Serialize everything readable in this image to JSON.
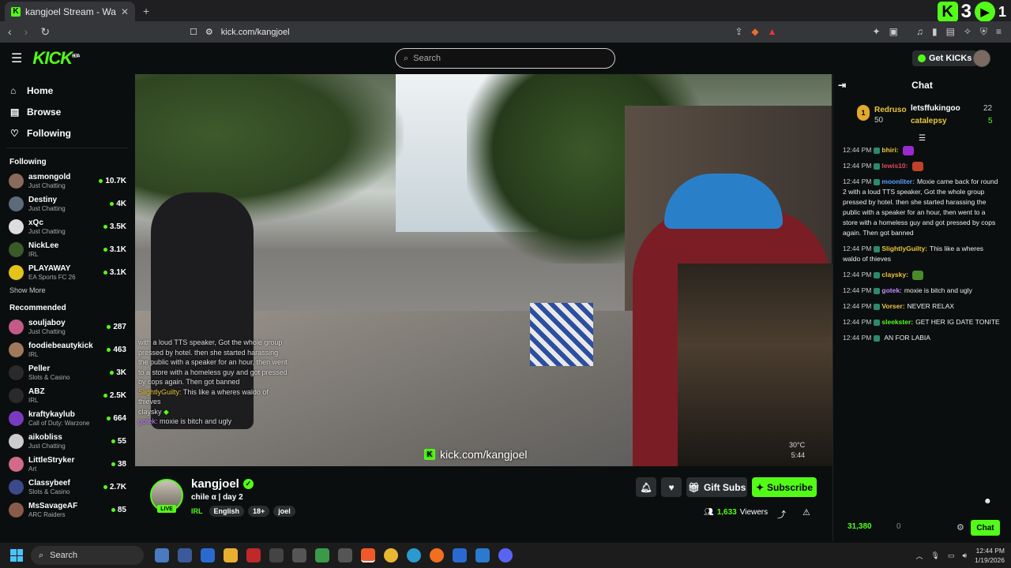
{
  "browser": {
    "tab_title": "kangjoel Stream - Watch Live",
    "url": "kick.com/kangjoel",
    "corner_count1": "3",
    "corner_count2": "1"
  },
  "header": {
    "logo": "KICK",
    "logo_beta": "BETA",
    "search_placeholder": "Search",
    "get_kicks": "Get KICKs"
  },
  "sidebar": {
    "nav": [
      {
        "label": "Home",
        "icon": "home-icon"
      },
      {
        "label": "Browse",
        "icon": "browse-icon"
      },
      {
        "label": "Following",
        "icon": "heart-icon"
      }
    ],
    "following_title": "Following",
    "following": [
      {
        "name": "asmongold",
        "category": "Just Chatting",
        "viewers": "10.7K",
        "color": "#8a6a5a"
      },
      {
        "name": "Destiny",
        "category": "Just Chatting",
        "viewers": "4K",
        "color": "#5c6b7a"
      },
      {
        "name": "xQc",
        "category": "Just Chatting",
        "viewers": "3.5K",
        "color": "#dddddd"
      },
      {
        "name": "NickLee",
        "category": "IRL",
        "viewers": "3.1K",
        "color": "#3a5a2a"
      },
      {
        "name": "PLAYAWAY",
        "category": "EA Sports FC 26",
        "viewers": "3.1K",
        "color": "#e3c21a"
      }
    ],
    "show_more": "Show More",
    "recommended_title": "Recommended",
    "recommended": [
      {
        "name": "souljaboy",
        "category": "Just Chatting",
        "viewers": "287",
        "color": "#c45a8a"
      },
      {
        "name": "foodiebeautykick",
        "category": "IRL",
        "viewers": "463",
        "color": "#a0785a"
      },
      {
        "name": "Peller",
        "category": "Slots & Casino",
        "viewers": "3K",
        "color": "#2a2a2a"
      },
      {
        "name": "ABZ",
        "category": "IRL",
        "viewers": "2.5K",
        "color": "#2a2a2a"
      },
      {
        "name": "kraftykaylub",
        "category": "Call of Duty: Warzone",
        "viewers": "664",
        "color": "#7a3ac0"
      },
      {
        "name": "aikobliss",
        "category": "Just Chatting",
        "viewers": "55",
        "color": "#cccccc"
      },
      {
        "name": "LittleStryker",
        "category": "Art",
        "viewers": "38",
        "color": "#d26a8a"
      },
      {
        "name": "Classybeef",
        "category": "Slots & Casino",
        "viewers": "2.7K",
        "color": "#3a4a8a"
      },
      {
        "name": "MsSavageAF",
        "category": "ARC Raiders",
        "viewers": "85",
        "color": "#8a5a4a"
      }
    ]
  },
  "video_overlay": {
    "chat_lines": [
      "with a loud TTS speaker, Got the whole group pressed by hotel. then she started harassing the public with a speaker for an hour, then went to a store with a homeless guy and got pressed by cops again. Then got banned"
    ],
    "guilty_user": "SlightlyGuilty:",
    "guilty_msg": "This like a wheres waldo of thieves",
    "claysky": "claysky",
    "gotek_user": "gotek:",
    "gotek_msg": "moxie is bitch and ugly",
    "url": "kick.com/kangjoel",
    "temp": "30°C",
    "time": "5:44"
  },
  "stream": {
    "name": "kangjoel",
    "title": "chile α | day 2",
    "live": "LIVE",
    "category": "IRL",
    "tags": [
      "English",
      "18+",
      "joel"
    ],
    "gift_subs": "Gift Subs",
    "subscribe": "Subscribe",
    "viewers": "1,633",
    "viewers_label": "Viewers"
  },
  "chat": {
    "title": "Chat",
    "leaderboard": {
      "rank1_medal": "1",
      "rank1_name": "Redruso",
      "rank1_val": "50",
      "rank2_name": "letsffukingoo",
      "rank2_val": "22",
      "rank3_name": "catalepsy",
      "rank3_val": "5"
    },
    "messages": [
      {
        "time": "12:44 PM",
        "user": "bhiri:",
        "color": "#e9c63a",
        "text": ""
      },
      {
        "time": "12:44 PM",
        "user": "lewis10:",
        "color": "#e0475a",
        "text": ""
      },
      {
        "time": "12:44 PM",
        "user": "moonliter:",
        "color": "#5aa0ff",
        "text": "Moxie came back for round 2 with a loud TTS speaker, Got the whole group pressed by hotel. then she started harassing the public with a speaker for an hour, then went to a store with a homeless guy and got pressed by cops again. Then got banned"
      },
      {
        "time": "12:44 PM",
        "user": "SlightlyGuilty:",
        "color": "#e9c63a",
        "text": "This like a wheres waldo of thieves"
      },
      {
        "time": "12:44 PM",
        "user": "claysky:",
        "color": "#e9c63a",
        "text": ""
      },
      {
        "time": "12:44 PM",
        "user": "gotek:",
        "color": "#c58aff",
        "text": "moxie is bitch and ugly"
      },
      {
        "time": "12:44 PM",
        "user": "Vorser:",
        "color": "#e9c63a",
        "text": "NEVER RELAX"
      },
      {
        "time": "12:44 PM",
        "user": "sleekster:",
        "color": "#53fc18",
        "text": "GET HER IG DATE TONITE"
      },
      {
        "time": "12:44 PM",
        "user": "",
        "color": "#e9c63a",
        "text": "AN FOR LABIA"
      }
    ],
    "points": "31,380",
    "points2": "0",
    "chat_button": "Chat"
  },
  "taskbar": {
    "search": "Search",
    "time": "12:44 PM",
    "date": "1/19/2026"
  }
}
